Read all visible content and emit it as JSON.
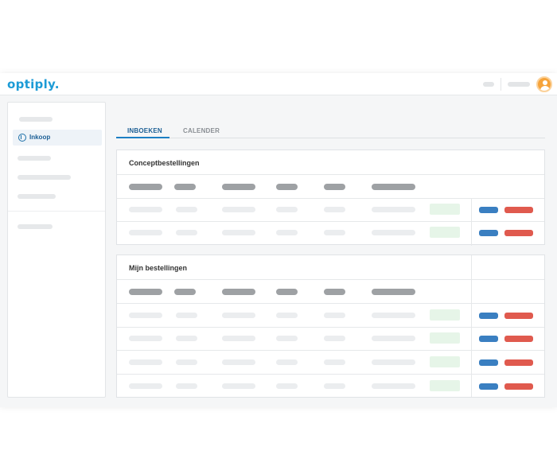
{
  "app": {
    "logo": "optiply."
  },
  "sidebar": {
    "items": [
      {
        "label": "Inkoop",
        "icon": "euro-circle-icon",
        "active": true
      }
    ]
  },
  "tabs": [
    {
      "label": "INBOEKEN",
      "active": true
    },
    {
      "label": "CALENDER",
      "active": false
    }
  ],
  "sections": {
    "concept": {
      "title": "Conceptbestellingen",
      "row_count": 2
    },
    "mine": {
      "title": "Mijn bestellingen",
      "row_count": 4
    }
  },
  "colors": {
    "brand": "#1c9bd6",
    "accent": "#1c7fc4",
    "action_primary": "#3a7fc1",
    "action_danger": "#e05a4e",
    "status_ok": "#e6f5e8"
  }
}
